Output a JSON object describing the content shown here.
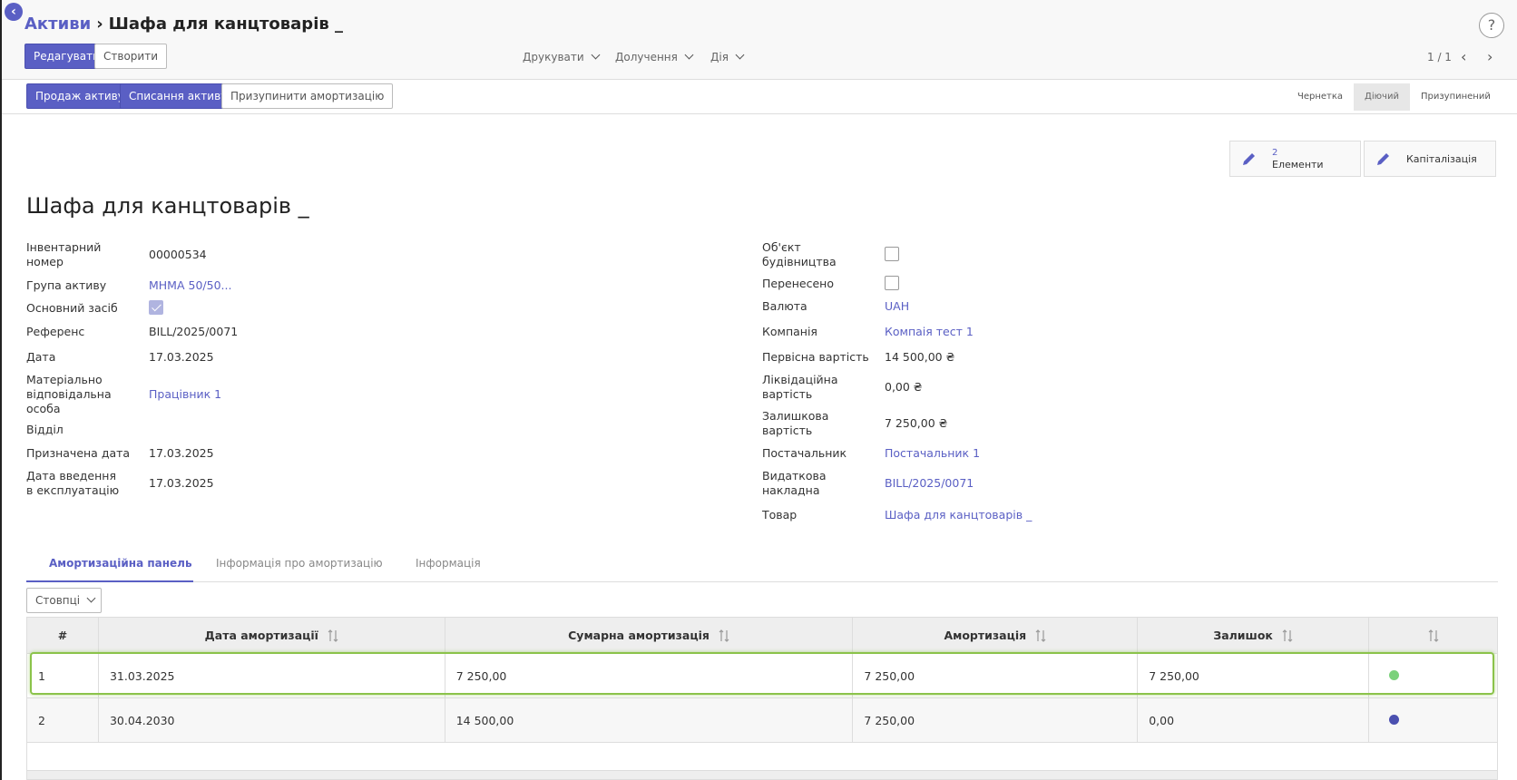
{
  "breadcrumb": {
    "parent": "Активи",
    "current": "Шафа для канцтоварів _"
  },
  "help_label": "?",
  "toolbar": {
    "edit_label": "Редагувати",
    "create_label": "Створити",
    "print_label": "Друкувати",
    "attach_label": "Долучення",
    "action_label": "Дія",
    "pager": "1 / 1"
  },
  "header_buttons": {
    "sell": "Продаж активу",
    "dispose": "Списання активу",
    "pause": "Призупинити амортизацію"
  },
  "status_steps": [
    "Чернетка",
    "Діючий",
    "Призупинений"
  ],
  "status_active": "Діючий",
  "smart_buttons": {
    "items_count": "2",
    "items_label": "Елементи",
    "capitalization_label": "Капіталізація"
  },
  "title": "Шафа для канцтоварів _",
  "left_fields": {
    "inventory_label": "Інвентарний номер",
    "inventory_value": "00000534",
    "group_label": "Група активу",
    "group_value": "МНМА 50/50...",
    "fixed_label": "Основний засіб",
    "fixed_checked": true,
    "ref_label": "Референс",
    "ref_value": "BILL/2025/0071",
    "date_label": "Дата",
    "date_value": "17.03.2025",
    "responsible_label": "Матеріально відповідальна особа",
    "responsible_value": "Працівник 1",
    "dept_label": "Відділ",
    "assigned_label": "Призначена дата",
    "assigned_value": "17.03.2025",
    "commission_label": "Дата введення в експлуатацію",
    "commission_value": "17.03.2025"
  },
  "right_fields": {
    "construction_label": "Об'єкт будівництва",
    "construction_checked": false,
    "moved_label": "Перенесено",
    "moved_checked": false,
    "currency_label": "Валюта",
    "currency_value": "UAH",
    "company_label": "Компанія",
    "company_value": "Компаія тест 1",
    "initial_label": "Первісна вартість",
    "initial_value": "14 500,00 ₴",
    "salvage_label": "Ліквідаційна вартість",
    "salvage_value": "0,00 ₴",
    "residual_label": "Залишкова вартість",
    "residual_value": "7 250,00 ₴",
    "vendor_label": "Постачальник",
    "vendor_value": "Постачальник 1",
    "invoice_label": "Видаткова накладна",
    "invoice_value": "BILL/2025/0071",
    "product_label": "Товар",
    "product_value": "Шафа для канцтоварів _"
  },
  "tabs": [
    "Амортизаційна панель",
    "Інформація про амортизацію",
    "Інформація"
  ],
  "columns_button": "Стовпці",
  "table": {
    "headers": [
      "#",
      "Дата амортизації",
      "Сумарна амортизація",
      "Амортизація",
      "Залишок"
    ],
    "rows": [
      {
        "num": "1",
        "date": "31.03.2025",
        "cumulative": "7 250,00",
        "amount": "7 250,00",
        "remaining": "7 250,00",
        "status_color": "#7bd17b"
      },
      {
        "num": "2",
        "date": "30.04.2030",
        "cumulative": "14 500,00",
        "amount": "7 250,00",
        "remaining": "0,00",
        "status_color": "#4b50b0"
      }
    ]
  },
  "colors": {
    "accent": "#5a5fc4",
    "highlight": "#8bc34a"
  }
}
